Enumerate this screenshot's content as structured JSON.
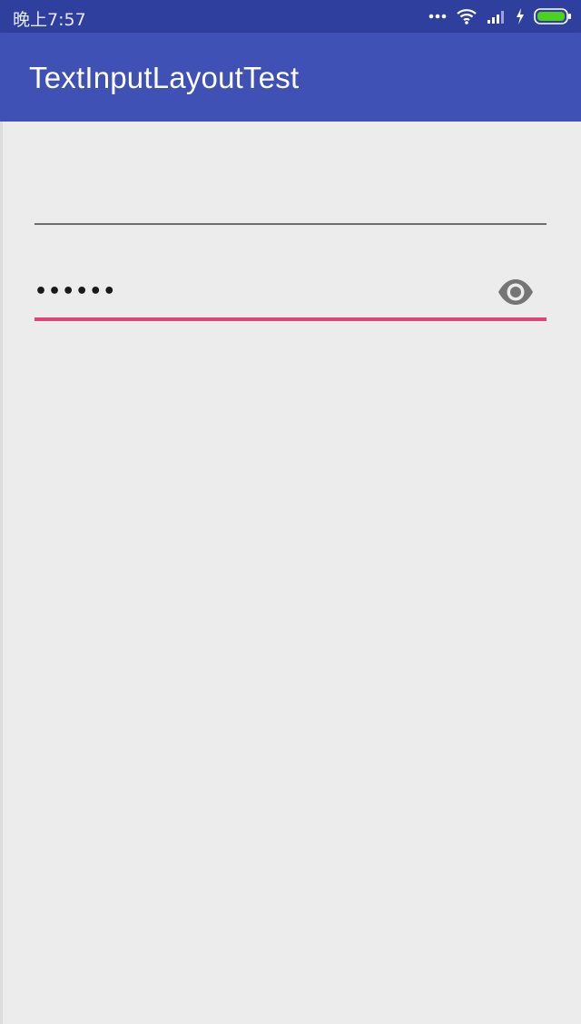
{
  "status_bar": {
    "time": "晚上7:57"
  },
  "app_bar": {
    "title": "TextInputLayoutTest"
  },
  "form": {
    "username": {
      "value": ""
    },
    "password": {
      "masked_value": "••••••",
      "toggle_icon": "eye-icon"
    }
  },
  "colors": {
    "primary": "#3f51b5",
    "primary_dark": "#2f3f9e",
    "accent": "#e0457a",
    "background": "#ececec"
  }
}
